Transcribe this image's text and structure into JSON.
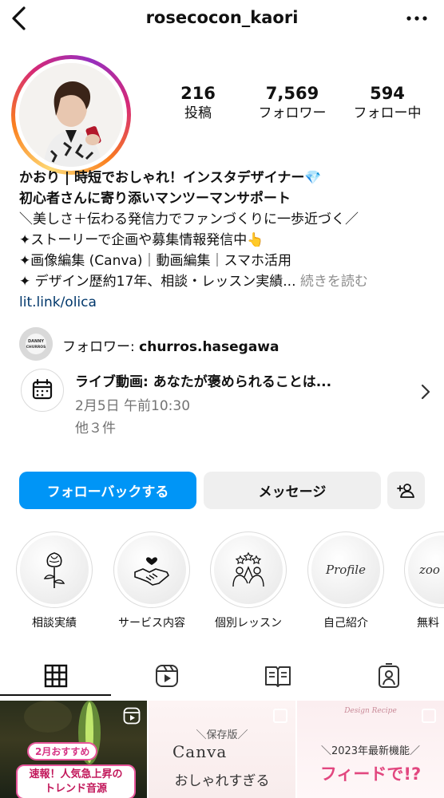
{
  "header": {
    "username": "rosecocon_kaori"
  },
  "stats": [
    {
      "value": "216",
      "label": "投稿"
    },
    {
      "value": "7,569",
      "label": "フォロワー"
    },
    {
      "value": "594",
      "label": "フォロー中"
    }
  ],
  "bio": {
    "name_line": "かおり | 時短でおしゃれ！インスタデザイナー💎",
    "line2": "初心者さんに寄り添いマンツーマンサポート",
    "line3": "＼美しさ＋伝わる発信力でファンづくりに一歩近づく／",
    "line4": "✦ストーリーで企画や募集情報発信中👆",
    "line5": "✦画像編集 (Canva)｜動画編集｜スマホ活用",
    "line6": "✦ デザイン歴約17年、相談・レッスン実績...",
    "more": "続きを読む",
    "link": "lit.link/olica"
  },
  "followed_by": {
    "prefix": "フォロワー: ",
    "name": "churros.hasegawa",
    "avatar_text": "DANNY CHURROS"
  },
  "event": {
    "title": "ライブ動画: あなたが褒められることは...",
    "date": "2月5日 午前10:30",
    "more": "他３件"
  },
  "actions": {
    "follow_back": "フォローバックする",
    "message": "メッセージ"
  },
  "highlights": [
    {
      "label": "相談実績",
      "icon": "rose-icon"
    },
    {
      "label": "サービス内容",
      "icon": "handshake-icon"
    },
    {
      "label": "個別レッスン",
      "icon": "team-stars-icon"
    },
    {
      "label": "自己紹介",
      "icon": "profile-script",
      "script": "Profile"
    },
    {
      "label": "無料",
      "icon": "zoom-text",
      "script": "zoo"
    }
  ],
  "tabs": [
    "grid-icon",
    "reels-icon",
    "guide-icon",
    "tagged-icon"
  ],
  "posts": [
    {
      "badge": "2月おすすめ",
      "box": "速報！人気急上昇の\nトレンド音源"
    },
    {
      "sub": "＼保存版／",
      "title": "Canva",
      "line": "おしゃれすぎる"
    },
    {
      "small": "Design Recipe",
      "sub": "＼2023年最新機能／",
      "title": "フィードで!?"
    }
  ],
  "colors": {
    "accent": "#0095f6",
    "link": "#00376b",
    "muted": "#737373",
    "button_bg": "#efefef",
    "pink": "#e2477f"
  }
}
